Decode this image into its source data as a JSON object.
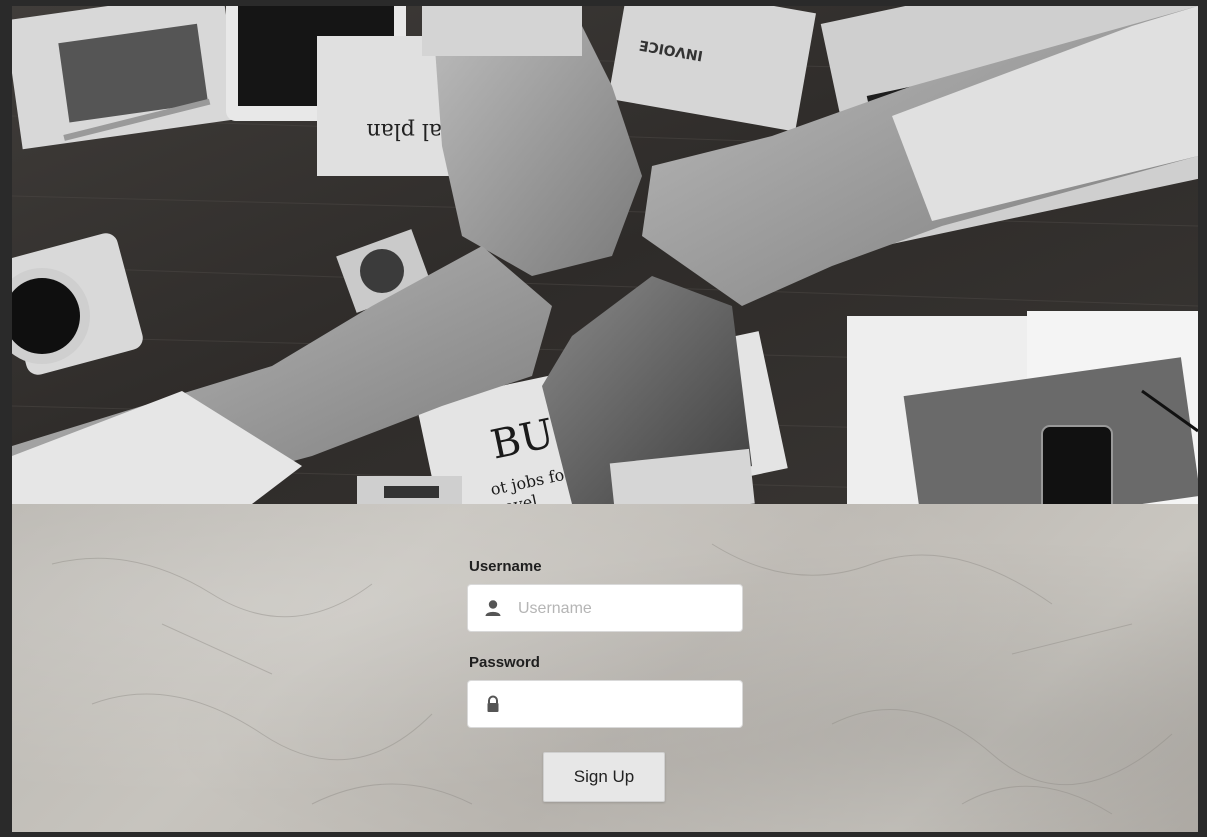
{
  "form": {
    "username_label": "Username",
    "username_placeholder": "Username",
    "username_value": "",
    "password_label": "Password",
    "password_placeholder": "",
    "password_value": "",
    "submit_label": "Sign Up"
  },
  "hero_image_text": {
    "newspaper_headline": "BUS",
    "newspaper_subline": "ot jobs for people",
    "newspaper_subline2": "avel",
    "invoice_label": "INVOICE",
    "plan_label": "al plan"
  },
  "icons": {
    "username_icon": "user-icon",
    "password_icon": "lock-icon"
  },
  "colors": {
    "button_bg": "#e7e7e7",
    "input_bg": "#ffffff",
    "label_text": "#1f1f1f"
  }
}
